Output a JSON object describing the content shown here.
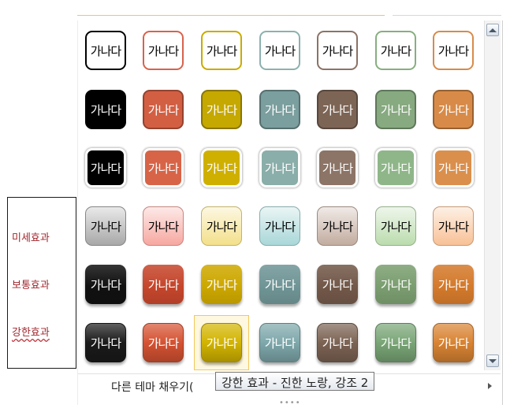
{
  "swatch_text": "가나다",
  "gallery": {
    "rows": [
      {
        "style": "outline",
        "colors": [
          "#000000",
          "#d7634d",
          "#c9ab00",
          "#8cb1ae",
          "#8b7366",
          "#88ae7f",
          "#d68b4b"
        ]
      },
      {
        "style": "solid",
        "colors": [
          "#000000",
          "#d35f43",
          "#c5a800",
          "#7b9e9e",
          "#7d6556",
          "#87aa80",
          "#d88b48"
        ]
      },
      {
        "style": "solid-white-border",
        "colors": [
          "#000000",
          "#d76447",
          "#cfb000",
          "#8aaeaa",
          "#8c7466",
          "#8fb689",
          "#da8f4c"
        ]
      },
      {
        "style": "light-gradient",
        "colors": [
          "#a8a8a8",
          "#f6a8a0",
          "#f3e08a",
          "#a9d7d8",
          "#c2ac9f",
          "#bbdcae",
          "#f8c196"
        ]
      },
      {
        "style": "moderate",
        "colors": [
          "#111111",
          "#c5462c",
          "#cda800",
          "#709596",
          "#725849",
          "#7b9e70",
          "#d47a2c"
        ]
      },
      {
        "style": "intense",
        "colors": [
          "#1a1a1a",
          "#d55232",
          "#d2b400",
          "#7ea8ab",
          "#7c6354",
          "#7aa677",
          "#d98433"
        ]
      }
    ],
    "selected": {
      "row": 5,
      "col": 2
    }
  },
  "footer": {
    "more_fills_label": "다른 테마 채우기(",
    "grip": "••••"
  },
  "tooltip": {
    "text": "강한 효과 - 진한 노랑, 강조 2"
  },
  "annotations": [
    "미세효과",
    "보통효과",
    "강한효과"
  ]
}
